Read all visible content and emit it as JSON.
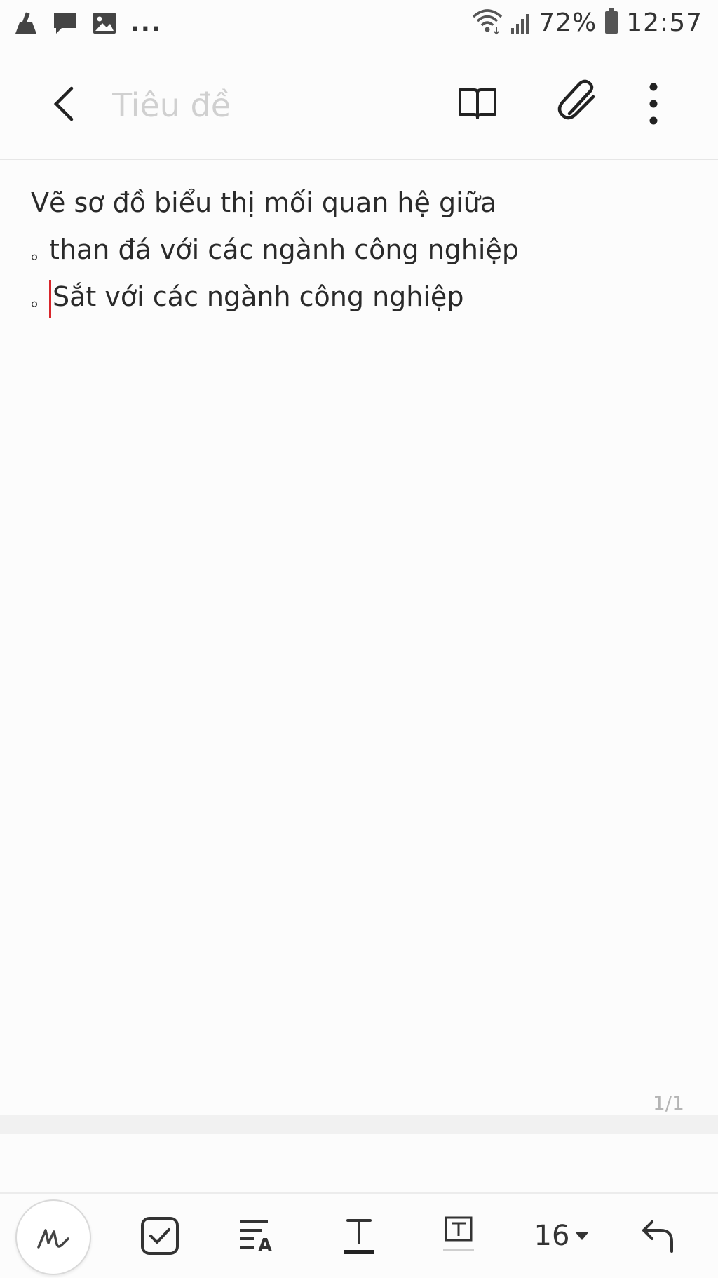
{
  "status_bar": {
    "icons_left": [
      "cleaner-icon",
      "message-icon",
      "gallery-icon"
    ],
    "more_indicator": "...",
    "icons_right": [
      "wifi-icon",
      "signal-icon",
      "battery-icon"
    ],
    "battery": "72%",
    "time": "12:57"
  },
  "header": {
    "title_placeholder": "Tiêu đề",
    "title_value": "",
    "icons": [
      "back-icon",
      "reading-mode-icon",
      "attachment-icon",
      "more-options-icon"
    ]
  },
  "note": {
    "lines": [
      {
        "bullet": "",
        "text": "Vẽ sơ đồ biểu thị mối quan hệ giữa"
      },
      {
        "bullet": "。",
        "text": "than đá với các ngành công nghiệp"
      },
      {
        "bullet": "。",
        "text": "Sắt với các ngành công nghiệp"
      }
    ],
    "page_counter": "1/1"
  },
  "toolbar": {
    "items": [
      "handwriting-icon",
      "checkbox-icon",
      "text-format-icon",
      "text-style-icon",
      "text-box-icon",
      "font-size",
      "undo-icon"
    ],
    "font_size": "16"
  },
  "colors": {
    "background": "#fcfcfc",
    "cursor": "#d8262b",
    "placeholder": "#d0d0d0"
  }
}
